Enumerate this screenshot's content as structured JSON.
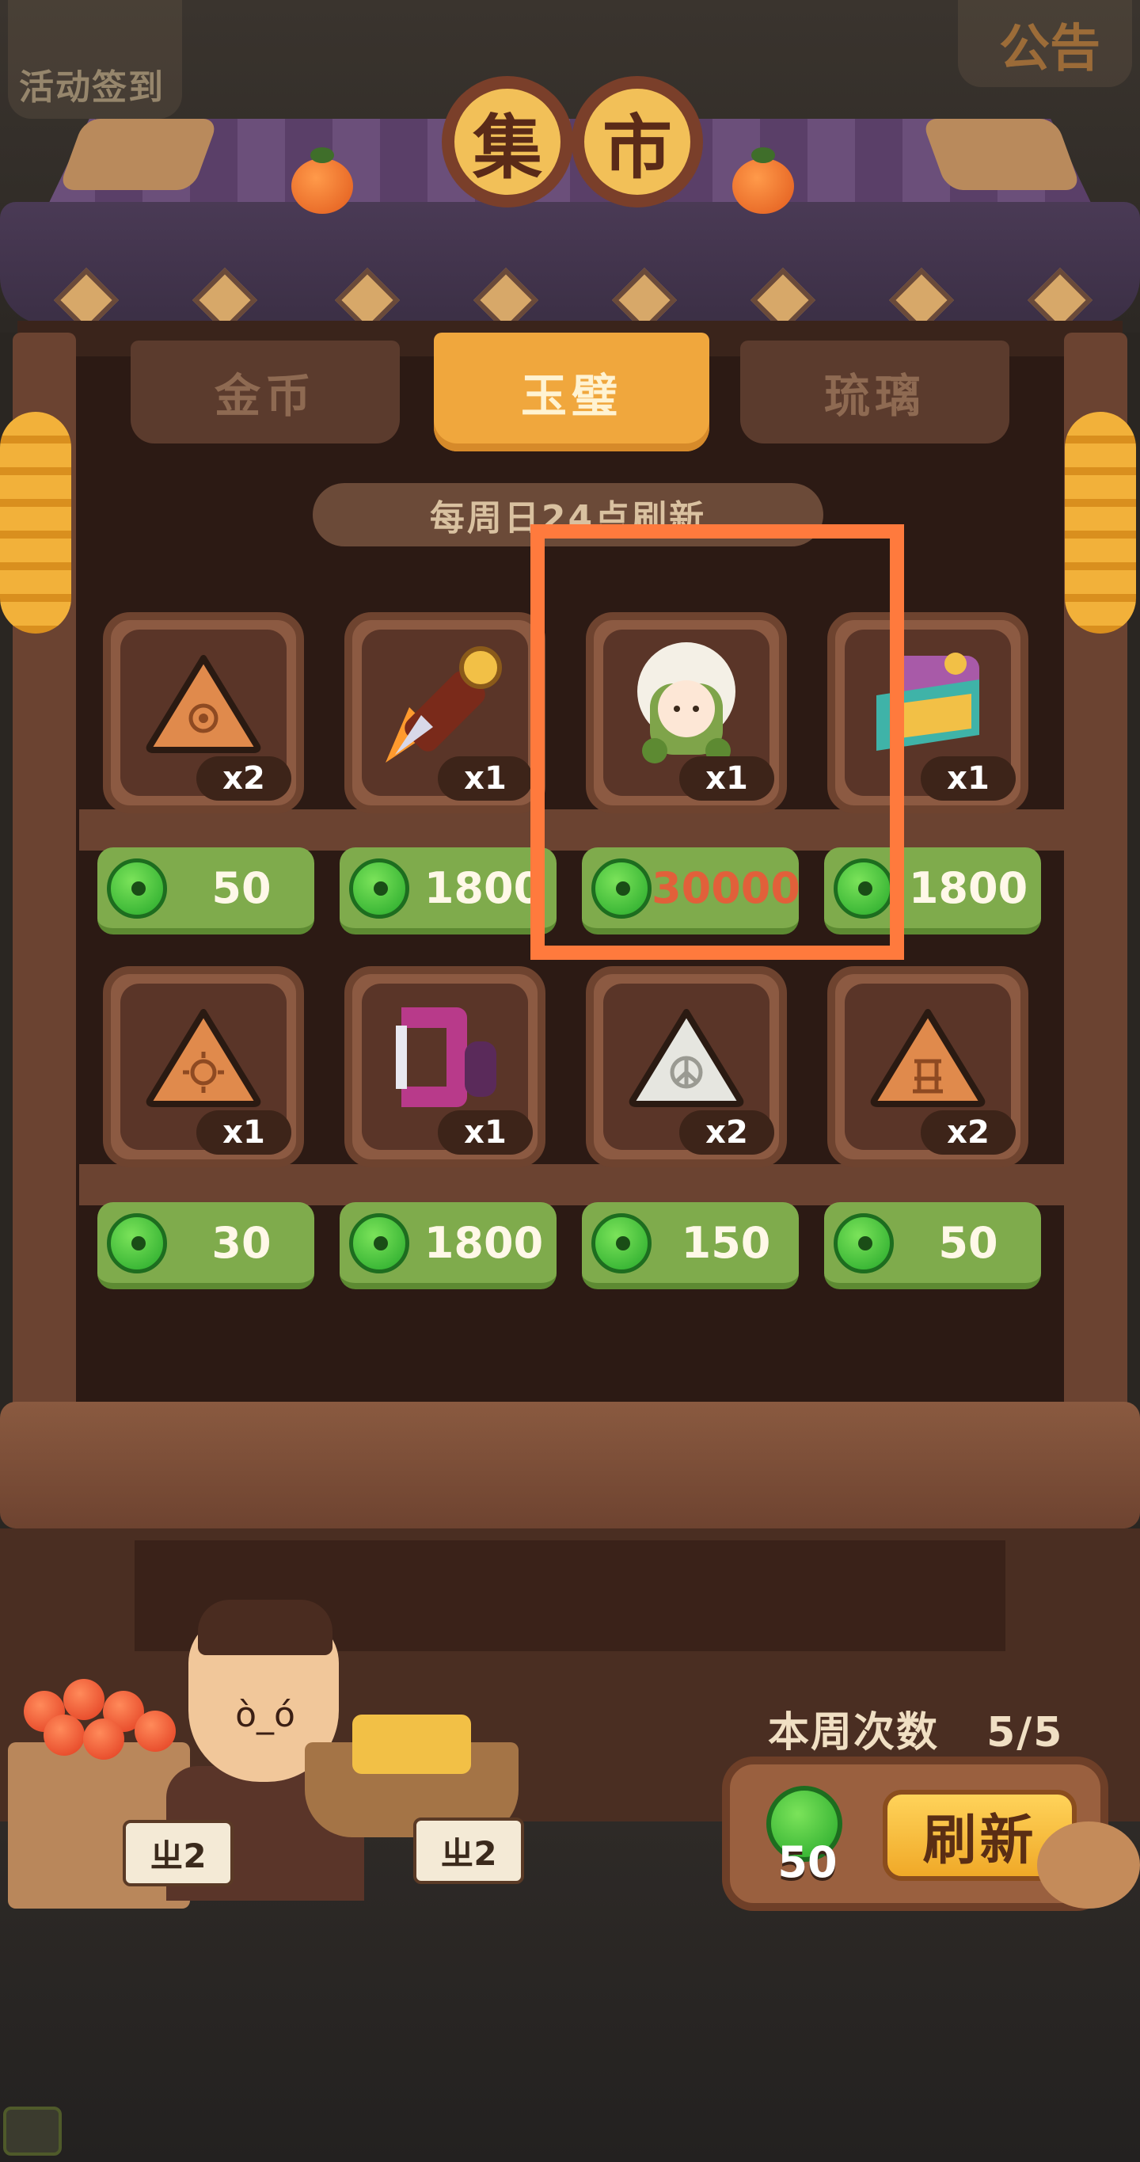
{
  "top_buttons": {
    "left_label": "活动签到",
    "right_label": "公告"
  },
  "header": {
    "title_chars": [
      "集",
      "市"
    ]
  },
  "tabs": [
    {
      "label": "金币",
      "active": false
    },
    {
      "label": "玉璧",
      "active": true
    },
    {
      "label": "琉璃",
      "active": false
    }
  ],
  "refresh_note": "每周日24点刷新",
  "currency_icon": "jade-coin-icon",
  "items": [
    {
      "icon": "triangle-token-icon",
      "qty": "x2",
      "price": "50"
    },
    {
      "icon": "chisel-icon",
      "qty": "x1",
      "price": "1800"
    },
    {
      "icon": "character-avatar-icon",
      "qty": "x1",
      "price": "30000"
    },
    {
      "icon": "book-box-icon",
      "qty": "x1",
      "price": "1800"
    },
    {
      "icon": "sun-token-icon",
      "qty": "x1",
      "price": "30"
    },
    {
      "icon": "saw-icon",
      "qty": "x1",
      "price": "1800"
    },
    {
      "icon": "stone-token-icon",
      "qty": "x2",
      "price": "150"
    },
    {
      "icon": "glyph-token-icon",
      "qty": "x2",
      "price": "50"
    }
  ],
  "highlighted_item": 2,
  "stall_tags": [
    "ㄓ2",
    "ㄓ2"
  ],
  "weekly": {
    "label": "本周次数",
    "count": "5/5"
  },
  "refresh": {
    "cost": "50",
    "button_label": "刷新"
  },
  "colors": {
    "price_green": "#7fab4c",
    "highlight": "#ff7a3d",
    "active_tab": "#f0a73d",
    "expensive_price": "#e1603a"
  }
}
